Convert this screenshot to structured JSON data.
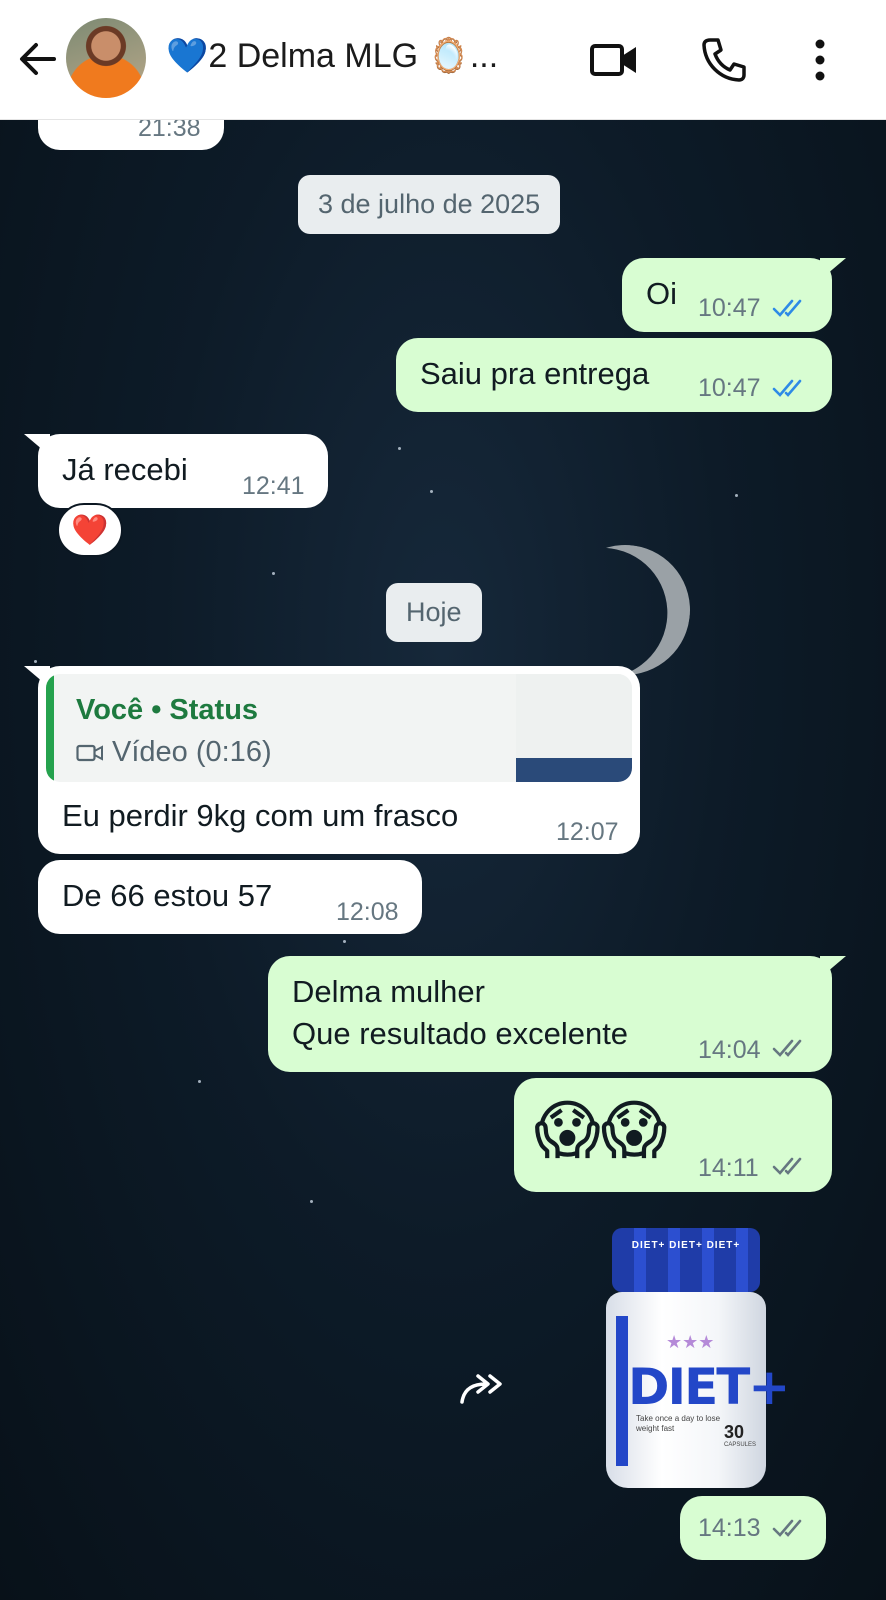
{
  "header": {
    "chat_name": "2 Delma MLG",
    "name_prefix_emoji": "💙",
    "name_suffix": "🪞...",
    "icons": [
      "back-arrow-icon",
      "video-call-icon",
      "phone-icon",
      "more-vert-icon"
    ]
  },
  "messages": {
    "partial_top": {
      "time": "21:38"
    },
    "date1": "3 de julho de 2025",
    "m1": {
      "text": "Oi",
      "time": "10:47",
      "status": "read"
    },
    "m2": {
      "text": "Saiu pra entrega",
      "time": "10:47",
      "status": "read"
    },
    "m3": {
      "text": "Já recebi",
      "time": "12:41",
      "reaction": "❤️"
    },
    "date2": "Hoje",
    "m4": {
      "quote_title": "Você • Status",
      "quote_subtitle": "Vídeo (0:16)",
      "text": "Eu perdir 9kg com um frasco",
      "time": "12:07"
    },
    "m5": {
      "text": "De 66 estou 57",
      "time": "12:08"
    },
    "m6": {
      "line1": "Delma mulher",
      "line2": "Que resultado excelente",
      "time": "14:04",
      "status": "delivered"
    },
    "m7": {
      "emoji": "😱😱",
      "time": "14:11",
      "status": "delivered"
    },
    "m8": {
      "image": {
        "brand": "DIET+",
        "cap_text": "DIET+ DIET+ DIET+",
        "tagline": "Take once a day to lose weight fast",
        "count": "30",
        "count_label": "CAPSULES"
      },
      "time": "14:13",
      "status": "delivered"
    }
  },
  "colors": {
    "incoming": "#ffffff",
    "outgoing": "#d8fdd2",
    "read_ticks": "#2e8ae6",
    "delivered_ticks": "#667781",
    "quote_accent": "#25a24d"
  }
}
